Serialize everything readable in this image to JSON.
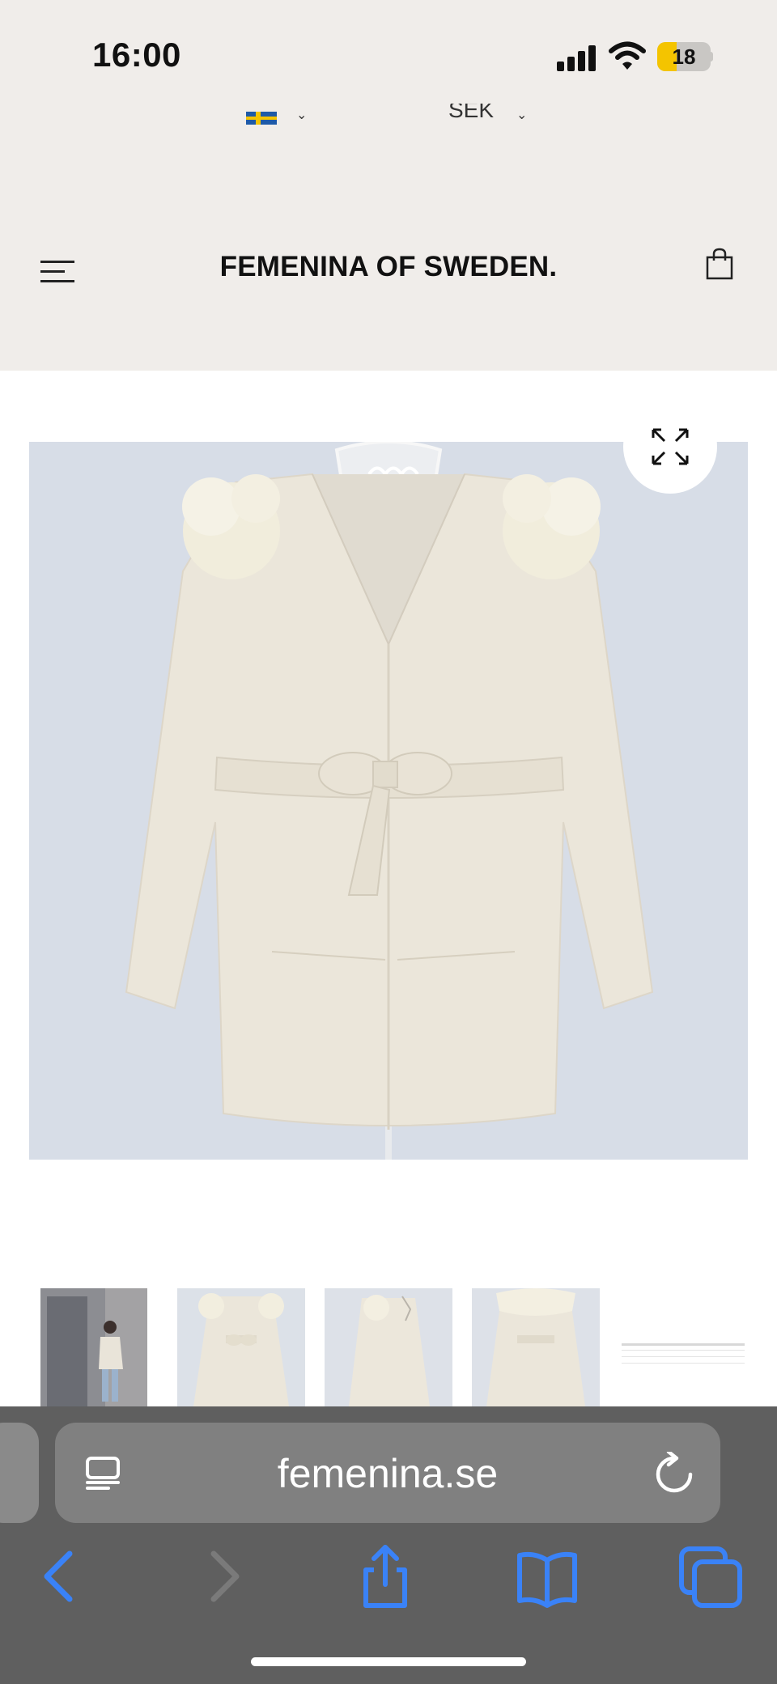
{
  "status_bar": {
    "time": "16:00",
    "battery_level": "18",
    "icons": [
      "signal-icon",
      "wifi-icon",
      "battery-icon"
    ]
  },
  "site_header": {
    "currency_partial": "SEK",
    "brand": "FEMENINA OF SWEDEN.",
    "icons": [
      "menu-icon",
      "shopping-bag-icon",
      "sweden-flag-icon"
    ]
  },
  "product": {
    "thumbnail_count": 5,
    "icons": [
      "expand-icon"
    ]
  },
  "browser": {
    "url": "femenina.se",
    "icons": [
      "reader-icon",
      "reload-icon",
      "back-icon",
      "forward-icon",
      "share-icon",
      "bookmarks-icon",
      "tabs-icon"
    ]
  },
  "colors": {
    "header_bg": "#f0edea",
    "image_bg": "#d7dde7",
    "coat": "#ebe6da",
    "browser_chrome": "#5f5f5f",
    "accent_blue": "#3a82f7"
  }
}
